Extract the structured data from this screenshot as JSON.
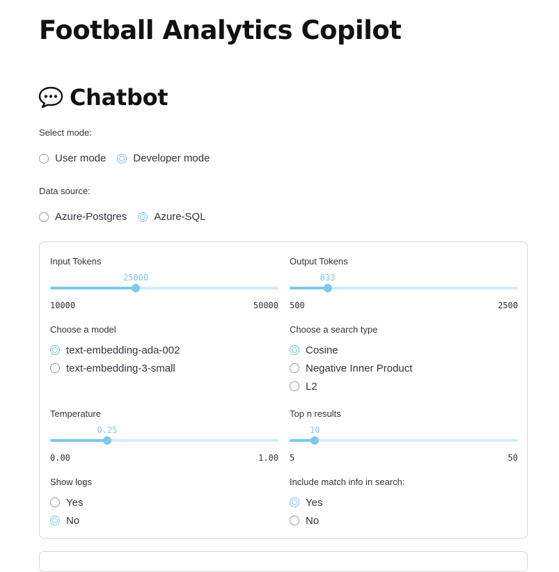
{
  "app": {
    "title": "Football Analytics Copilot"
  },
  "chat": {
    "heading": "Chatbot",
    "icon": "speech-bubble-icon"
  },
  "mode": {
    "label": "Select mode:",
    "options": [
      "User mode",
      "Developer mode"
    ],
    "selected": "Developer mode"
  },
  "source": {
    "label": "Data source:",
    "options": [
      "Azure-Postgres",
      "Azure-SQL"
    ],
    "selected": "Azure-SQL"
  },
  "settings": {
    "input_tokens": {
      "label": "Input Tokens",
      "value": "25000",
      "min": "10000",
      "max": "50000",
      "fraction": 0.375
    },
    "output_tokens": {
      "label": "Output Tokens",
      "value": "833",
      "min": "500",
      "max": "2500",
      "fraction": 0.1665
    },
    "model": {
      "label": "Choose a model",
      "options": [
        "text-embedding-ada-002",
        "text-embedding-3-small"
      ],
      "selected": "text-embedding-ada-002"
    },
    "search_type": {
      "label": "Choose a search type",
      "options": [
        "Cosine",
        "Negative Inner Product",
        "L2"
      ],
      "selected": "Cosine"
    },
    "temperature": {
      "label": "Temperature",
      "value": "0.25",
      "min": "0.00",
      "max": "1.00",
      "fraction": 0.25
    },
    "top_n": {
      "label": "Top n results",
      "value": "10",
      "min": "5",
      "max": "50",
      "fraction": 0.111
    },
    "show_logs": {
      "label": "Show logs",
      "options": [
        "Yes",
        "No"
      ],
      "selected": "No"
    },
    "match_info": {
      "label": "Include match info in search:",
      "options": [
        "Yes",
        "No"
      ],
      "selected": "Yes"
    }
  },
  "colors": {
    "accent": "#7cc9ec",
    "track": "#d3ecf8",
    "text": "#31333f",
    "heading": "#111111"
  }
}
